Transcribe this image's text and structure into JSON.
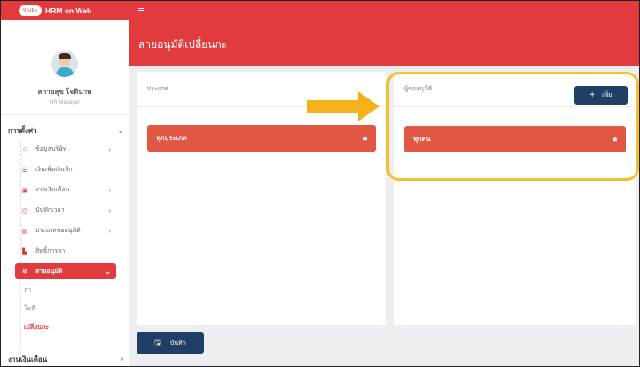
{
  "app": {
    "title": "HRM on Web",
    "logo_text": "Spike"
  },
  "user": {
    "name": "สกายสุข โจตินาท",
    "role": "HR Manager"
  },
  "sidebar": {
    "section1": "การตั้งค่า",
    "items": [
      {
        "label": "ข้อมูลบริษัท",
        "icon": "home-icon"
      },
      {
        "label": "เงินเพิ่มเงินหัก",
        "icon": "list-icon"
      },
      {
        "label": "งวดเงินเดือน",
        "icon": "money-icon"
      },
      {
        "label": "บันทึกเวลา",
        "icon": "clock-icon"
      },
      {
        "label": "ประเภทขออนุมัติ",
        "icon": "card-icon"
      },
      {
        "label": "สิทธิ์การลา",
        "icon": "file-icon"
      },
      {
        "label": "สายอนุมัติ",
        "icon": "check-circle-icon"
      }
    ],
    "subitems": [
      "ลา",
      "โอที",
      "เปลี่ยนกะ"
    ],
    "section2": "งานเงินเดือน"
  },
  "page": {
    "title": "สายอนุมัติเปลี่ยนกะ"
  },
  "left_panel": {
    "title": "ประเภท",
    "item": "ทุกประเภท"
  },
  "right_panel": {
    "title": "ผู้ขออนุมัติ",
    "add_label": "เพิ่ม",
    "item": "ทุกคน"
  },
  "save_label": "บันทึก",
  "colors": {
    "brand": "#e23b3e",
    "item": "#e15744",
    "button": "#213e66",
    "highlight": "#f3c12a"
  }
}
